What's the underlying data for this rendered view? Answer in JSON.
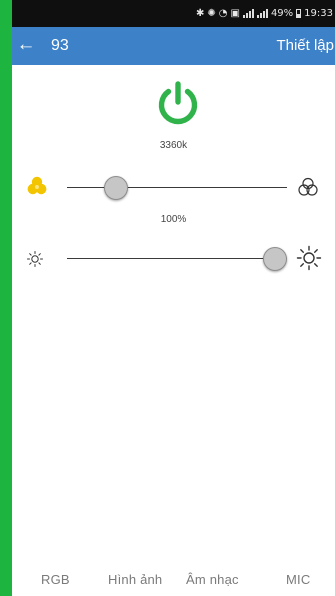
{
  "status_bar": {
    "battery_percent": "49%",
    "time": "19:33"
  },
  "app_bar": {
    "title": "93",
    "action_label": "Thiết lập"
  },
  "power": {
    "color": "#31b34c"
  },
  "color_temp": {
    "value_label": "3360k",
    "level": 0.19,
    "left_icon": "color-dots-icon",
    "left_icon_color": "#f2c500",
    "right_icon": "color-circles-icon"
  },
  "brightness": {
    "value_label": "100%",
    "level": 1.0,
    "left_icon": "sun-dim-icon",
    "right_icon": "sun-bright-icon"
  },
  "tabs": [
    {
      "label": "RGB"
    },
    {
      "label": "Hình ảnh"
    },
    {
      "label": "Âm nhạc"
    },
    {
      "label": "MIC"
    }
  ]
}
